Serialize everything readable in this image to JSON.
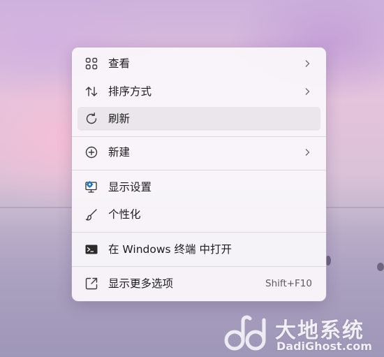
{
  "context_menu": {
    "items": [
      {
        "label": "查看",
        "icon": "grid-view-icon",
        "has_submenu": true
      },
      {
        "label": "排序方式",
        "icon": "sort-arrows-icon",
        "has_submenu": true
      },
      {
        "label": "刷新",
        "icon": "refresh-icon",
        "has_submenu": false
      },
      {
        "label": "新建",
        "icon": "add-circle-icon",
        "has_submenu": true
      },
      {
        "label": "显示设置",
        "icon": "display-settings-icon",
        "has_submenu": false
      },
      {
        "label": "个性化",
        "icon": "brush-icon",
        "has_submenu": false
      },
      {
        "label": "在 Windows 终端 中打开",
        "icon": "terminal-icon",
        "has_submenu": false
      },
      {
        "label": "显示更多选项",
        "icon": "open-external-icon",
        "has_submenu": false,
        "shortcut": "Shift+F10"
      }
    ],
    "highlighted_item": "刷新"
  },
  "watermark": {
    "title": "大地系统",
    "url": "DadiGhost.com"
  },
  "colors": {
    "menu_background": "#f9f6fa",
    "highlight": "#ebe6ec",
    "display_icon_accent": "#1a73c7"
  }
}
